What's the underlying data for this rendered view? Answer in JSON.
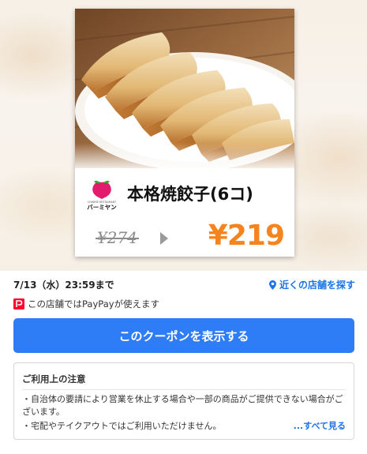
{
  "coupon": {
    "product_name": "本格焼餃子(6コ)",
    "old_price": "¥274",
    "new_price": "¥219",
    "store_logo_icon": "peach-logo-icon",
    "store_logo_text_top": "CHINESE RESTAURANT",
    "store_logo_text": "バーミヤン",
    "accent_color": "#f5841f"
  },
  "details": {
    "deadline": "7/13（水）23:59まで",
    "nearby_label": "近くの店舗を探す",
    "paypay_text": "この店舗ではPayPayが使えます",
    "paypay_icon_letter": "P"
  },
  "actions": {
    "show_coupon_label": "このクーポンを表示する",
    "button_color": "#2f7df6"
  },
  "notes": {
    "title": "ご利用上の注意",
    "lines": [
      "・自治体の要請により営業を休止する場合や一部の商品がご提供できない場合がございます。",
      "・宅配やテイクアウトではご利用いただけません。"
    ],
    "see_all_label": "...すべて見る"
  }
}
